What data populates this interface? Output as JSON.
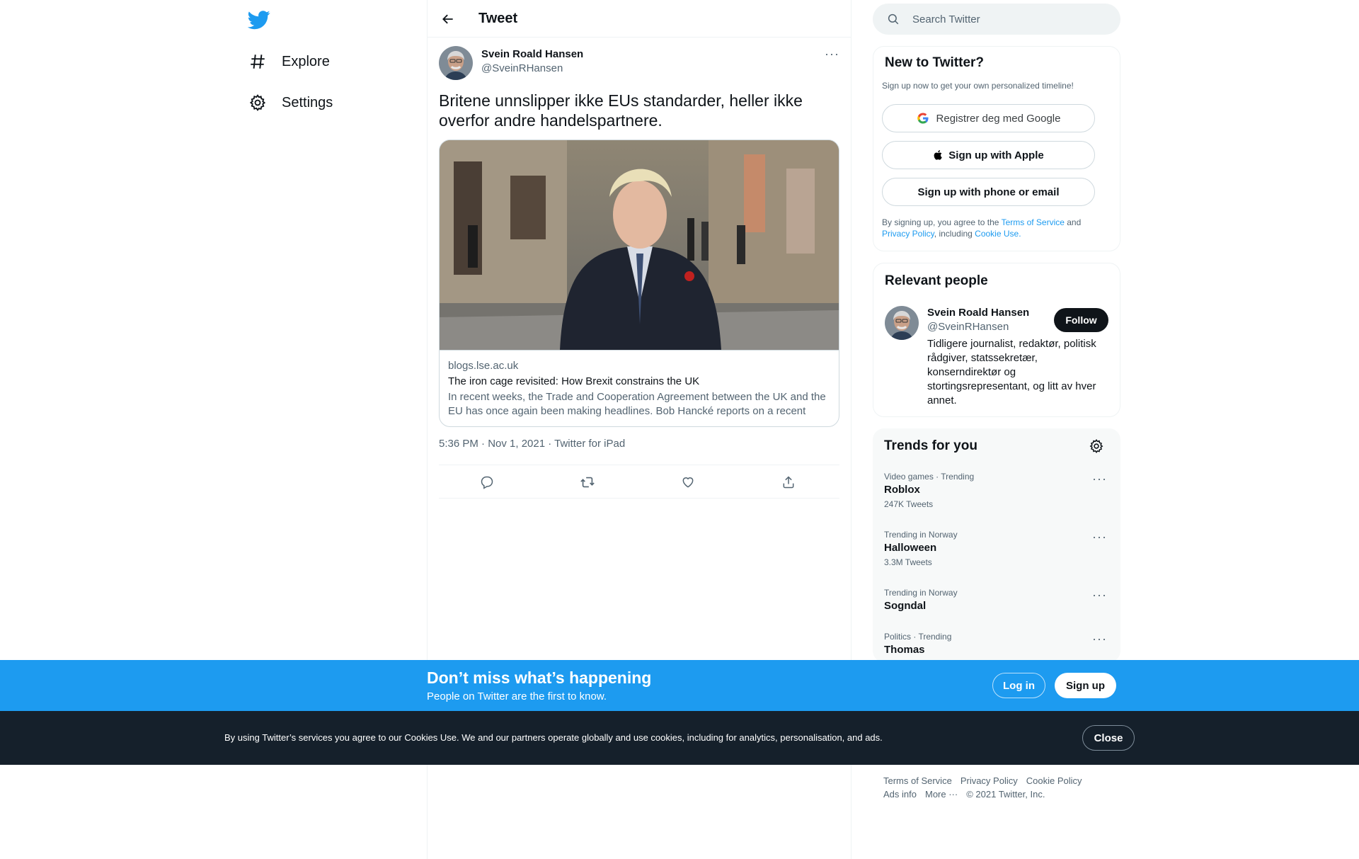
{
  "nav": {
    "explore_label": "Explore",
    "settings_label": "Settings"
  },
  "header": {
    "title": "Tweet"
  },
  "tweet": {
    "author_name": "Svein Roald Hansen",
    "author_handle": "@SveinRHansen",
    "text": "Britene unnslipper ikke EUs standarder, heller ikke overfor andre handelspartnere.",
    "card": {
      "domain": "blogs.lse.ac.uk",
      "title": "The iron cage revisited: How Brexit constrains the UK",
      "description": "In recent weeks, the Trade and Cooperation Agreement between the UK and the EU has once again been making headlines. Bob Hancké reports on a recent stu…"
    },
    "meta": "5:36 PM · Nov 1, 2021 · Twitter for iPad"
  },
  "search": {
    "placeholder": "Search Twitter"
  },
  "signup_panel": {
    "title": "New to Twitter?",
    "subtitle": "Sign up now to get your own personalized timeline!",
    "google_label": "Registrer deg med Google",
    "apple_label": "Sign up with Apple",
    "phone_label": "Sign up with phone or email",
    "legal_prefix": "By signing up, you agree to the ",
    "terms": "Terms of Service",
    "and": " and",
    "privacy": "Privacy Policy",
    "including": ", including ",
    "cookie": "Cookie Use."
  },
  "relevant": {
    "title": "Relevant people",
    "name": "Svein Roald Hansen",
    "handle": "@SveinRHansen",
    "follow_label": "Follow",
    "bio": "Tidligere journalist, redaktør, politisk rådgiver, statssekretær, konserndirektør og stortingsrepresentant, og litt av hver annet."
  },
  "trends": {
    "title": "Trends for you",
    "items": [
      {
        "context": "Video games · Trending",
        "name": "Roblox",
        "count": "247K Tweets"
      },
      {
        "context": "Trending in Norway",
        "name": "Halloween",
        "count": "3.3M Tweets"
      },
      {
        "context": "Trending in Norway",
        "name": "Sogndal",
        "count": ""
      },
      {
        "context": "Politics · Trending",
        "name": "Thomas",
        "count": ""
      }
    ]
  },
  "footer": {
    "terms": "Terms of Service",
    "privacy": "Privacy Policy",
    "cookie": "Cookie Policy",
    "ads": "Ads info",
    "more": "More ···",
    "copyright": "© 2021 Twitter, Inc."
  },
  "banner": {
    "title": "Don’t miss what’s happening",
    "subtitle": "People on Twitter are the first to know.",
    "login_label": "Log in",
    "signup_label": "Sign up"
  },
  "cookie_bar": {
    "text": "By using Twitter’s services you agree to our Cookies Use. We and our partners operate globally and use cookies, including for analytics, personalisation, and ads.",
    "close_label": "Close"
  },
  "colors": {
    "brand": "#1d9bf0",
    "text": "#0f1419",
    "muted": "#536471",
    "cookie_bg": "#15202b"
  }
}
